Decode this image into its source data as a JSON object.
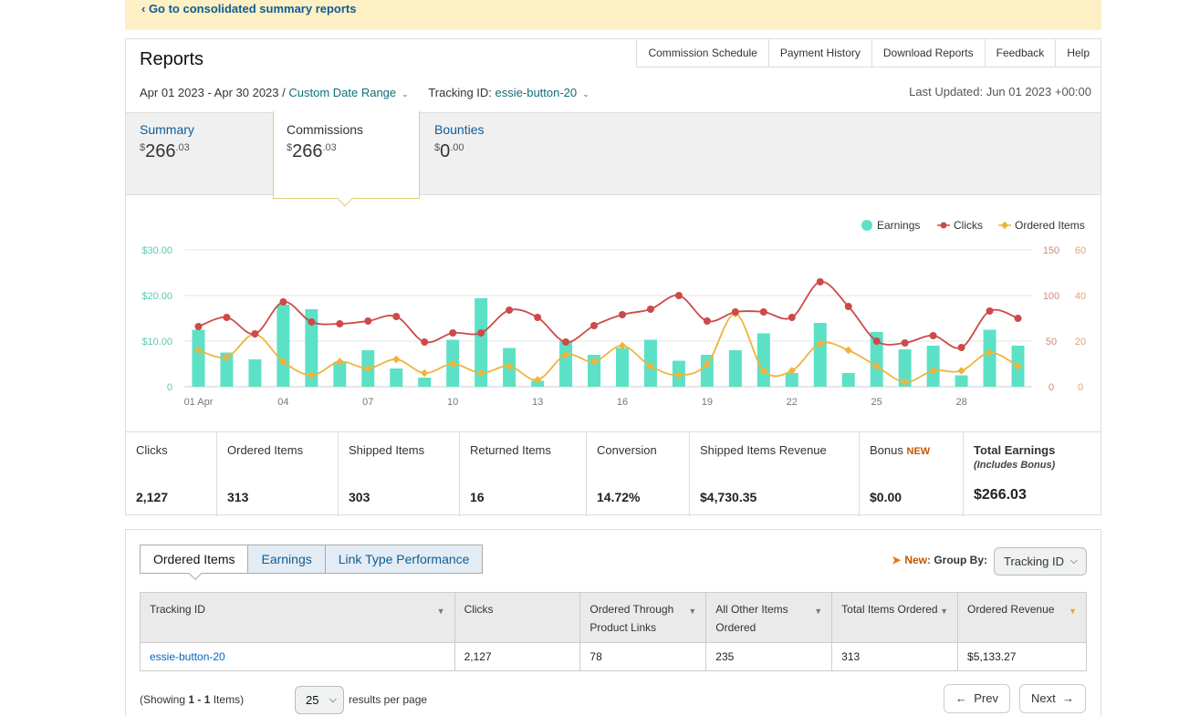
{
  "banner": {
    "link": "‹ Go to consolidated summary reports"
  },
  "header": {
    "title": "Reports",
    "nav": [
      "Commission Schedule",
      "Payment History",
      "Download Reports",
      "Feedback",
      "Help"
    ],
    "date_range": "Apr 01 2023 - Apr 30 2023",
    "date_sep": " / ",
    "custom_range": "Custom Date Range",
    "tracking_label": "Tracking ID:",
    "tracking_id": "essie-button-20",
    "last_updated": "Last Updated: Jun 01 2023 +00:00"
  },
  "summary_tabs": [
    {
      "label": "Summary",
      "currency": "$",
      "whole": "266",
      "cents": ".03"
    },
    {
      "label": "Commissions",
      "currency": "$",
      "whole": "266",
      "cents": ".03"
    },
    {
      "label": "Bounties",
      "currency": "$",
      "whole": "0",
      "cents": ".00"
    }
  ],
  "chart_data": {
    "type": "bar",
    "x": [
      "01 Apr",
      "02",
      "03",
      "04",
      "05",
      "06",
      "07",
      "08",
      "09",
      "10",
      "11",
      "12",
      "13",
      "14",
      "15",
      "16",
      "17",
      "18",
      "19",
      "20",
      "21",
      "22",
      "23",
      "24",
      "25",
      "26",
      "27",
      "28",
      "29",
      "30"
    ],
    "x_tick_labels": [
      "01 Apr",
      "04",
      "07",
      "10",
      "13",
      "16",
      "19",
      "22",
      "25",
      "28"
    ],
    "series": [
      {
        "name": "Earnings",
        "kind": "bar",
        "axis": "left",
        "color": "#5ce1c6",
        "values": [
          12.5,
          7.5,
          6.0,
          18.0,
          17.0,
          5.5,
          8.0,
          4.0,
          2.0,
          10.3,
          19.4,
          8.5,
          1.3,
          10.0,
          7.0,
          8.5,
          10.3,
          5.7,
          7.0,
          8.0,
          11.7,
          3.0,
          14.0,
          3.0,
          12.0,
          8.2,
          9.0,
          2.5,
          12.5,
          9.0
        ]
      },
      {
        "name": "Clicks",
        "kind": "line",
        "axis": "right",
        "color": "#cc4a4a",
        "values": [
          66,
          76,
          58,
          93,
          71,
          69,
          72,
          77,
          49,
          59,
          59,
          84,
          76,
          49,
          67,
          79,
          85,
          100,
          72,
          82,
          82,
          76,
          115,
          88,
          50,
          48,
          56,
          43,
          83,
          75
        ]
      },
      {
        "name": "Ordered Items",
        "kind": "line",
        "axis": "right2",
        "color": "#f0b43c",
        "values": [
          16,
          13,
          23,
          11,
          5,
          11,
          8,
          12,
          6,
          10,
          6,
          9,
          3,
          14,
          11,
          18,
          9,
          5,
          10,
          32,
          7,
          7,
          19,
          16,
          9,
          2,
          7,
          7,
          15,
          9
        ]
      }
    ],
    "y_left": {
      "ticks": [
        "0",
        "$10.00",
        "$20.00",
        "$30.00"
      ],
      "ylim": [
        0,
        30
      ]
    },
    "y_right": {
      "ticks": [
        "0",
        "50",
        "100",
        "150"
      ],
      "ylim": [
        0,
        150
      ]
    },
    "y_right2": {
      "ticks": [
        "0",
        "20",
        "40",
        "60"
      ],
      "ylim": [
        0,
        60
      ]
    },
    "legend_position": "top-right",
    "grid": true
  },
  "stats": [
    {
      "label": "Clicks",
      "value": "2,127"
    },
    {
      "label": "Ordered Items",
      "value": "313"
    },
    {
      "label": "Shipped Items",
      "value": "303"
    },
    {
      "label": "Returned Items",
      "value": "16"
    },
    {
      "label": "Conversion",
      "value": "14.72%"
    },
    {
      "label": "Shipped Items Revenue",
      "value": "$4,730.35"
    },
    {
      "label": "Bonus",
      "badge": "NEW",
      "value": "$0.00"
    },
    {
      "label": "Total Earnings",
      "sub": "(Includes Bonus)",
      "value": "$266.03"
    }
  ],
  "bottom": {
    "tabs": [
      "Ordered Items",
      "Earnings",
      "Link Type Performance"
    ],
    "group_new": "New:",
    "group_label": "Group By:",
    "group_value": "Tracking ID",
    "columns": [
      "Tracking ID",
      "Clicks",
      "Ordered Through Product Links",
      "All Other Items Ordered",
      "Total Items Ordered",
      "Ordered Revenue"
    ],
    "rows": [
      [
        "essie-button-20",
        "2,127",
        "78",
        "235",
        "313",
        "$5,133.27"
      ]
    ],
    "showing_pre": "(Showing ",
    "showing_range": "1 - 1",
    "showing_post": " Items)",
    "per_page": "25",
    "per_page_label": "results per page",
    "prev": "Prev",
    "next": "Next"
  }
}
